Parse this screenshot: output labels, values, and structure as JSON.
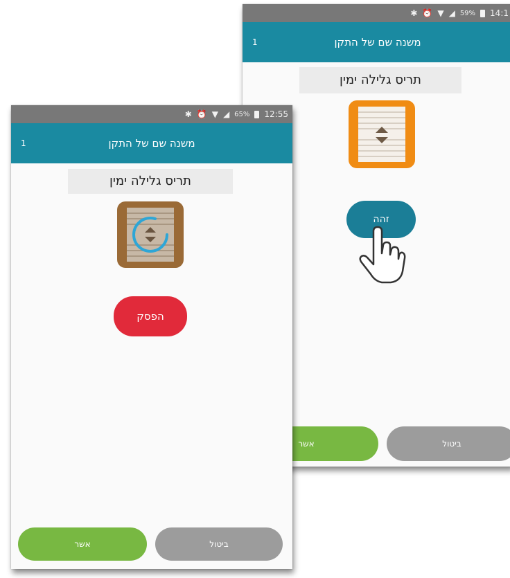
{
  "screens": [
    {
      "id": "back",
      "status_bar": {
        "battery": "59%",
        "time": "14:1"
      },
      "app_bar": {
        "title": "משנה שם של התקן",
        "count": "1"
      },
      "device_name": "תריס גלילה ימין",
      "device_icon": "roller-shutter-icon",
      "icon_color": "#f08c14",
      "action_button": {
        "label": "זהה",
        "color": "#1b7e97"
      },
      "pointer": "hand-cursor-icon",
      "confirm_label": "אשר",
      "cancel_label": "ביטול"
    },
    {
      "id": "front",
      "status_bar": {
        "battery": "65%",
        "time": "12:55"
      },
      "app_bar": {
        "title": "משנה שם של התקן",
        "count": "1"
      },
      "device_name": "תריס גלילה ימין",
      "device_icon": "roller-shutter-icon",
      "icon_color": "#9a6a36",
      "action_button": {
        "label": "הפסק",
        "color": "#e12a3a"
      },
      "confirm_label": "אשר",
      "cancel_label": "ביטול"
    }
  ],
  "colors": {
    "app_bar": "#1a8aa1",
    "status_bar": "#787878",
    "confirm": "#78b842",
    "cancel": "#9c9c9c"
  }
}
